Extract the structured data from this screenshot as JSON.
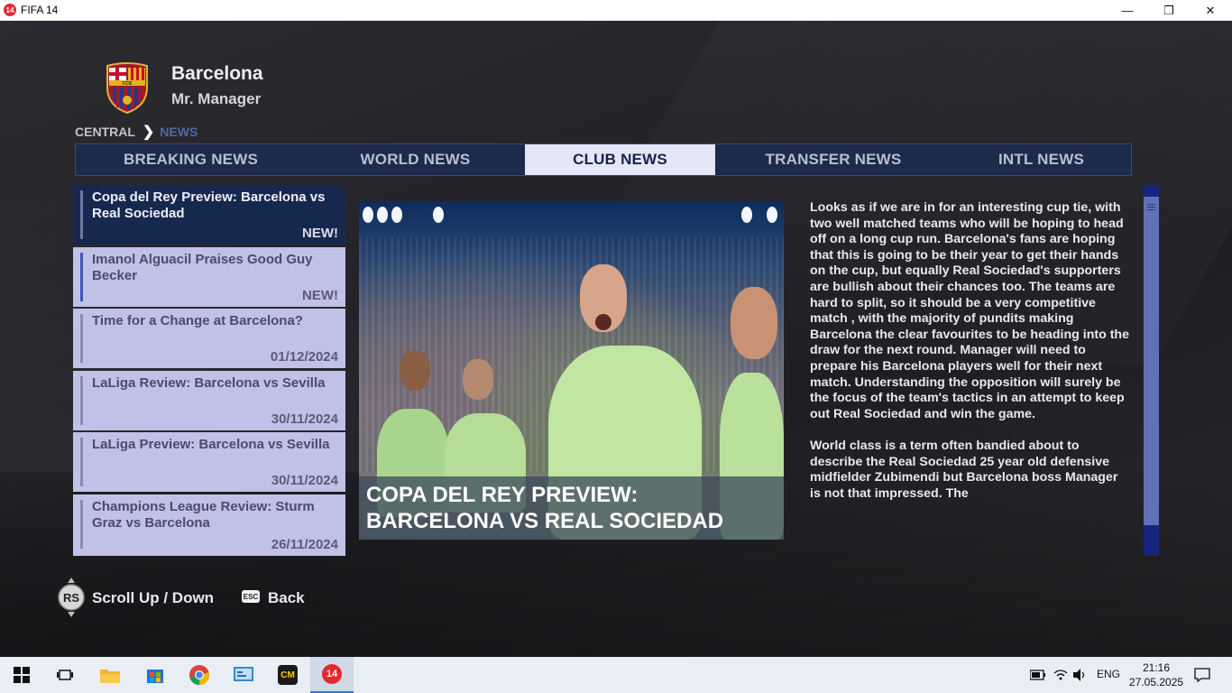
{
  "window": {
    "title": "FIFA 14",
    "app_icon_text": "14",
    "minimize_label": "—",
    "maximize_label": "❐",
    "close_label": "✕"
  },
  "header": {
    "club_name": "Barcelona",
    "manager_name": "Mr. Manager",
    "crest_text": "FCB"
  },
  "breadcrumb": {
    "root": "CENTRAL",
    "separator": "❯",
    "current": "NEWS"
  },
  "tabs": [
    {
      "label": "BREAKING NEWS",
      "active": false
    },
    {
      "label": "WORLD NEWS",
      "active": false
    },
    {
      "label": "CLUB NEWS",
      "active": true
    },
    {
      "label": "TRANSFER NEWS",
      "active": false
    },
    {
      "label": "INTL NEWS",
      "active": false
    }
  ],
  "news_list": [
    {
      "title": "Copa del Rey Preview: Barcelona vs Real Sociedad",
      "meta": "NEW!",
      "selected": true
    },
    {
      "title": " Imanol Alguacil Praises Good Guy Becker",
      "meta": "NEW!",
      "selected": false
    },
    {
      "title": "Time for a Change at Barcelona?",
      "meta": "01/12/2024",
      "selected": false
    },
    {
      "title": "LaLiga Review: Barcelona vs Sevilla",
      "meta": "30/11/2024",
      "selected": false
    },
    {
      "title": "LaLiga Preview: Barcelona vs Sevilla",
      "meta": "30/11/2024",
      "selected": false
    },
    {
      "title": "Champions League Review: Sturm Graz vs Barcelona",
      "meta": "26/11/2024",
      "selected": false
    }
  ],
  "article": {
    "headline": "COPA DEL REY PREVIEW: BARCELONA VS REAL SOCIEDAD",
    "paragraphs": [
      "Looks as if we are in for an interesting cup tie, with two well matched teams who will be hoping to head off on a long cup run. Barcelona's fans are hoping that this is going to be their year to get their hands on the cup, but equally Real Sociedad's supporters are bullish about their chances too. The teams are hard to split, so it should be a very competitive match , with the majority of pundits making Barcelona the clear favourites to be heading into the draw for the next round. Manager will need to prepare his Barcelona players well for their next match. Understanding the opposition will surely be the focus of the team's tactics in an attempt to keep out Real Sociedad and win the game.",
      "World class is a term often bandied about to describe the Real Sociedad 25 year old defensive midfielder Zubimendi but Barcelona boss Manager is not that impressed. The"
    ]
  },
  "footer": {
    "rs_icon_text": "RS",
    "scroll_label": "Scroll Up / Down",
    "esc_icon_text": "ESC",
    "back_label": "Back"
  },
  "taskbar": {
    "language": "ENG",
    "time": "21:16",
    "date": "27.05.2025",
    "cm_icon_text": "CM",
    "fifa_icon_text": "14"
  },
  "colors": {
    "tab_bar_bg": "#1c2a4b",
    "tab_active_bg": "#e5e6f6",
    "list_item_bg": "#c0c1e6",
    "list_selected_bg": "#17284e",
    "scrollbar": "#16257e",
    "accent_breadcrumb": "#4e6aa4"
  }
}
